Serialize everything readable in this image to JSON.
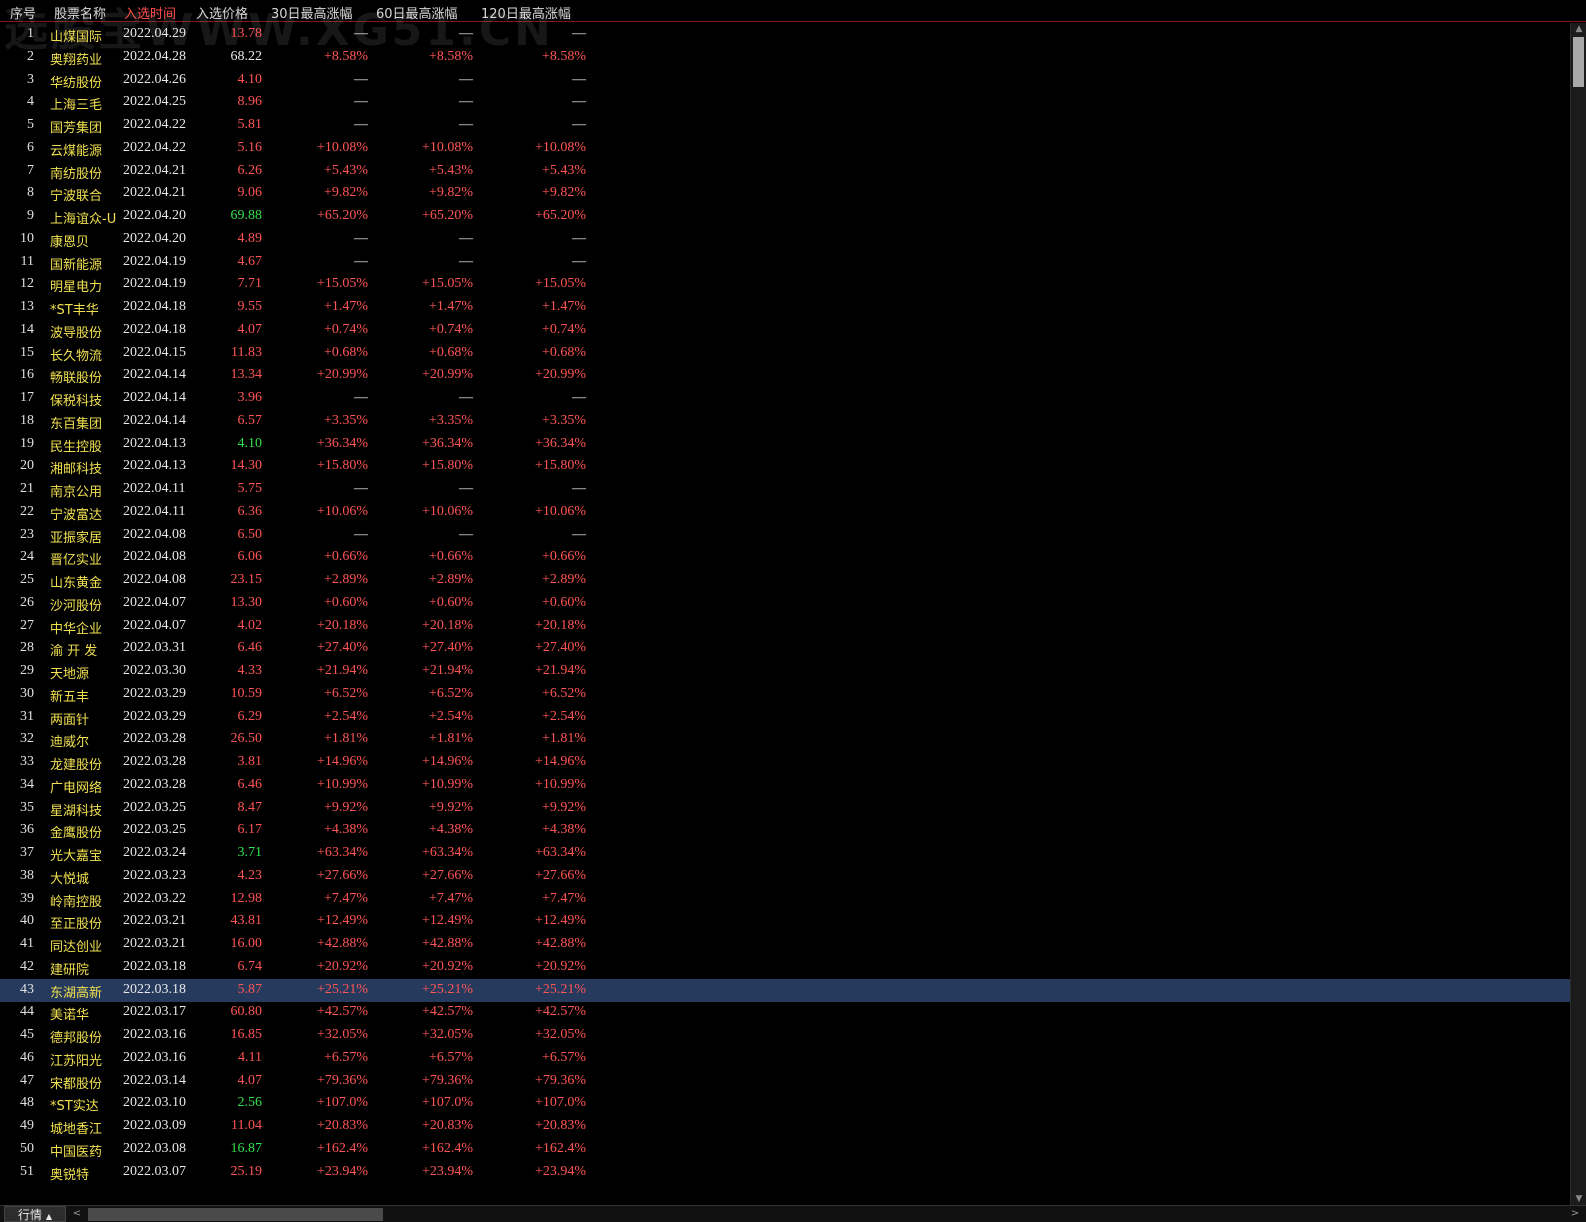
{
  "watermark": "选股宝WWW.XG51.CN",
  "header": {
    "columns": [
      "序号",
      "股票名称",
      "入选时间",
      "入选价格",
      "30日最高涨幅",
      "60日最高涨幅",
      "120日最高涨幅"
    ],
    "active_index": 2
  },
  "colors": {
    "red": "#ff5555",
    "green": "#33e04d",
    "white": "#e8e8e8",
    "name": "#f0e050",
    "selected_row": "#263a5e"
  },
  "selected_row": 43,
  "rows": [
    {
      "idx": "1",
      "name": "山煤国际",
      "date": "2022.04.29",
      "price": "13.78",
      "pc": "red",
      "p30": "—",
      "p60": "—",
      "p120": "—"
    },
    {
      "idx": "2",
      "name": "奥翔药业",
      "date": "2022.04.28",
      "price": "68.22",
      "pc": "white",
      "p30": "+8.58%",
      "p60": "+8.58%",
      "p120": "+8.58%"
    },
    {
      "idx": "3",
      "name": "华纺股份",
      "date": "2022.04.26",
      "price": "4.10",
      "pc": "red",
      "p30": "—",
      "p60": "—",
      "p120": "—"
    },
    {
      "idx": "4",
      "name": "上海三毛",
      "date": "2022.04.25",
      "price": "8.96",
      "pc": "red",
      "p30": "—",
      "p60": "—",
      "p120": "—"
    },
    {
      "idx": "5",
      "name": "国芳集团",
      "date": "2022.04.22",
      "price": "5.81",
      "pc": "red",
      "p30": "—",
      "p60": "—",
      "p120": "—"
    },
    {
      "idx": "6",
      "name": "云煤能源",
      "date": "2022.04.22",
      "price": "5.16",
      "pc": "red",
      "p30": "+10.08%",
      "p60": "+10.08%",
      "p120": "+10.08%"
    },
    {
      "idx": "7",
      "name": "南纺股份",
      "date": "2022.04.21",
      "price": "6.26",
      "pc": "red",
      "p30": "+5.43%",
      "p60": "+5.43%",
      "p120": "+5.43%"
    },
    {
      "idx": "8",
      "name": "宁波联合",
      "date": "2022.04.21",
      "price": "9.06",
      "pc": "red",
      "p30": "+9.82%",
      "p60": "+9.82%",
      "p120": "+9.82%"
    },
    {
      "idx": "9",
      "name": "上海谊众-U",
      "date": "2022.04.20",
      "price": "69.88",
      "pc": "green",
      "p30": "+65.20%",
      "p60": "+65.20%",
      "p120": "+65.20%"
    },
    {
      "idx": "10",
      "name": "康恩贝",
      "date": "2022.04.20",
      "price": "4.89",
      "pc": "red",
      "p30": "—",
      "p60": "—",
      "p120": "—"
    },
    {
      "idx": "11",
      "name": "国新能源",
      "date": "2022.04.19",
      "price": "4.67",
      "pc": "red",
      "p30": "—",
      "p60": "—",
      "p120": "—"
    },
    {
      "idx": "12",
      "name": "明星电力",
      "date": "2022.04.19",
      "price": "7.71",
      "pc": "red",
      "p30": "+15.05%",
      "p60": "+15.05%",
      "p120": "+15.05%"
    },
    {
      "idx": "13",
      "name": "*ST丰华",
      "date": "2022.04.18",
      "price": "9.55",
      "pc": "red",
      "p30": "+1.47%",
      "p60": "+1.47%",
      "p120": "+1.47%"
    },
    {
      "idx": "14",
      "name": "波导股份",
      "date": "2022.04.18",
      "price": "4.07",
      "pc": "red",
      "p30": "+0.74%",
      "p60": "+0.74%",
      "p120": "+0.74%"
    },
    {
      "idx": "15",
      "name": "长久物流",
      "date": "2022.04.15",
      "price": "11.83",
      "pc": "red",
      "p30": "+0.68%",
      "p60": "+0.68%",
      "p120": "+0.68%"
    },
    {
      "idx": "16",
      "name": "畅联股份",
      "date": "2022.04.14",
      "price": "13.34",
      "pc": "red",
      "p30": "+20.99%",
      "p60": "+20.99%",
      "p120": "+20.99%"
    },
    {
      "idx": "17",
      "name": "保税科技",
      "date": "2022.04.14",
      "price": "3.96",
      "pc": "red",
      "p30": "—",
      "p60": "—",
      "p120": "—"
    },
    {
      "idx": "18",
      "name": "东百集团",
      "date": "2022.04.14",
      "price": "6.57",
      "pc": "red",
      "p30": "+3.35%",
      "p60": "+3.35%",
      "p120": "+3.35%"
    },
    {
      "idx": "19",
      "name": "民生控股",
      "date": "2022.04.13",
      "price": "4.10",
      "pc": "green",
      "p30": "+36.34%",
      "p60": "+36.34%",
      "p120": "+36.34%"
    },
    {
      "idx": "20",
      "name": "湘邮科技",
      "date": "2022.04.13",
      "price": "14.30",
      "pc": "red",
      "p30": "+15.80%",
      "p60": "+15.80%",
      "p120": "+15.80%"
    },
    {
      "idx": "21",
      "name": "南京公用",
      "date": "2022.04.11",
      "price": "5.75",
      "pc": "red",
      "p30": "—",
      "p60": "—",
      "p120": "—"
    },
    {
      "idx": "22",
      "name": "宁波富达",
      "date": "2022.04.11",
      "price": "6.36",
      "pc": "red",
      "p30": "+10.06%",
      "p60": "+10.06%",
      "p120": "+10.06%"
    },
    {
      "idx": "23",
      "name": "亚振家居",
      "date": "2022.04.08",
      "price": "6.50",
      "pc": "red",
      "p30": "—",
      "p60": "—",
      "p120": "—"
    },
    {
      "idx": "24",
      "name": "晋亿实业",
      "date": "2022.04.08",
      "price": "6.06",
      "pc": "red",
      "p30": "+0.66%",
      "p60": "+0.66%",
      "p120": "+0.66%"
    },
    {
      "idx": "25",
      "name": "山东黄金",
      "date": "2022.04.08",
      "price": "23.15",
      "pc": "red",
      "p30": "+2.89%",
      "p60": "+2.89%",
      "p120": "+2.89%"
    },
    {
      "idx": "26",
      "name": "沙河股份",
      "date": "2022.04.07",
      "price": "13.30",
      "pc": "red",
      "p30": "+0.60%",
      "p60": "+0.60%",
      "p120": "+0.60%"
    },
    {
      "idx": "27",
      "name": "中华企业",
      "date": "2022.04.07",
      "price": "4.02",
      "pc": "red",
      "p30": "+20.18%",
      "p60": "+20.18%",
      "p120": "+20.18%"
    },
    {
      "idx": "28",
      "name": "渝 开 发",
      "date": "2022.03.31",
      "price": "6.46",
      "pc": "red",
      "p30": "+27.40%",
      "p60": "+27.40%",
      "p120": "+27.40%"
    },
    {
      "idx": "29",
      "name": "天地源",
      "date": "2022.03.30",
      "price": "4.33",
      "pc": "red",
      "p30": "+21.94%",
      "p60": "+21.94%",
      "p120": "+21.94%"
    },
    {
      "idx": "30",
      "name": "新五丰",
      "date": "2022.03.29",
      "price": "10.59",
      "pc": "red",
      "p30": "+6.52%",
      "p60": "+6.52%",
      "p120": "+6.52%"
    },
    {
      "idx": "31",
      "name": "两面针",
      "date": "2022.03.29",
      "price": "6.29",
      "pc": "red",
      "p30": "+2.54%",
      "p60": "+2.54%",
      "p120": "+2.54%"
    },
    {
      "idx": "32",
      "name": "迪威尔",
      "date": "2022.03.28",
      "price": "26.50",
      "pc": "red",
      "p30": "+1.81%",
      "p60": "+1.81%",
      "p120": "+1.81%"
    },
    {
      "idx": "33",
      "name": "龙建股份",
      "date": "2022.03.28",
      "price": "3.81",
      "pc": "red",
      "p30": "+14.96%",
      "p60": "+14.96%",
      "p120": "+14.96%"
    },
    {
      "idx": "34",
      "name": "广电网络",
      "date": "2022.03.28",
      "price": "6.46",
      "pc": "red",
      "p30": "+10.99%",
      "p60": "+10.99%",
      "p120": "+10.99%"
    },
    {
      "idx": "35",
      "name": "星湖科技",
      "date": "2022.03.25",
      "price": "8.47",
      "pc": "red",
      "p30": "+9.92%",
      "p60": "+9.92%",
      "p120": "+9.92%"
    },
    {
      "idx": "36",
      "name": "金鹰股份",
      "date": "2022.03.25",
      "price": "6.17",
      "pc": "red",
      "p30": "+4.38%",
      "p60": "+4.38%",
      "p120": "+4.38%"
    },
    {
      "idx": "37",
      "name": "光大嘉宝",
      "date": "2022.03.24",
      "price": "3.71",
      "pc": "green",
      "p30": "+63.34%",
      "p60": "+63.34%",
      "p120": "+63.34%"
    },
    {
      "idx": "38",
      "name": "大悦城",
      "date": "2022.03.23",
      "price": "4.23",
      "pc": "red",
      "p30": "+27.66%",
      "p60": "+27.66%",
      "p120": "+27.66%"
    },
    {
      "idx": "39",
      "name": "岭南控股",
      "date": "2022.03.22",
      "price": "12.98",
      "pc": "red",
      "p30": "+7.47%",
      "p60": "+7.47%",
      "p120": "+7.47%"
    },
    {
      "idx": "40",
      "name": "至正股份",
      "date": "2022.03.21",
      "price": "43.81",
      "pc": "red",
      "p30": "+12.49%",
      "p60": "+12.49%",
      "p120": "+12.49%"
    },
    {
      "idx": "41",
      "name": "同达创业",
      "date": "2022.03.21",
      "price": "16.00",
      "pc": "red",
      "p30": "+42.88%",
      "p60": "+42.88%",
      "p120": "+42.88%"
    },
    {
      "idx": "42",
      "name": "建研院",
      "date": "2022.03.18",
      "price": "6.74",
      "pc": "red",
      "p30": "+20.92%",
      "p60": "+20.92%",
      "p120": "+20.92%"
    },
    {
      "idx": "43",
      "name": "东湖高新",
      "date": "2022.03.18",
      "price": "5.87",
      "pc": "red",
      "p30": "+25.21%",
      "p60": "+25.21%",
      "p120": "+25.21%"
    },
    {
      "idx": "44",
      "name": "美诺华",
      "date": "2022.03.17",
      "price": "60.80",
      "pc": "red",
      "p30": "+42.57%",
      "p60": "+42.57%",
      "p120": "+42.57%"
    },
    {
      "idx": "45",
      "name": "德邦股份",
      "date": "2022.03.16",
      "price": "16.85",
      "pc": "red",
      "p30": "+32.05%",
      "p60": "+32.05%",
      "p120": "+32.05%"
    },
    {
      "idx": "46",
      "name": "江苏阳光",
      "date": "2022.03.16",
      "price": "4.11",
      "pc": "red",
      "p30": "+6.57%",
      "p60": "+6.57%",
      "p120": "+6.57%"
    },
    {
      "idx": "47",
      "name": "宋都股份",
      "date": "2022.03.14",
      "price": "4.07",
      "pc": "red",
      "p30": "+79.36%",
      "p60": "+79.36%",
      "p120": "+79.36%"
    },
    {
      "idx": "48",
      "name": "*ST实达",
      "date": "2022.03.10",
      "price": "2.56",
      "pc": "green",
      "p30": "+107.0%",
      "p60": "+107.0%",
      "p120": "+107.0%"
    },
    {
      "idx": "49",
      "name": "城地香江",
      "date": "2022.03.09",
      "price": "11.04",
      "pc": "red",
      "p30": "+20.83%",
      "p60": "+20.83%",
      "p120": "+20.83%"
    },
    {
      "idx": "50",
      "name": "中国医药",
      "date": "2022.03.08",
      "price": "16.87",
      "pc": "green",
      "p30": "+162.4%",
      "p60": "+162.4%",
      "p120": "+162.4%"
    },
    {
      "idx": "51",
      "name": "奥锐特",
      "date": "2022.03.07",
      "price": "25.19",
      "pc": "red",
      "p30": "+23.94%",
      "p60": "+23.94%",
      "p120": "+23.94%"
    }
  ],
  "bottom": {
    "tab_label": "行情",
    "tab_arrow": "▲",
    "scroll_left": "<",
    "scroll_right": ">"
  }
}
